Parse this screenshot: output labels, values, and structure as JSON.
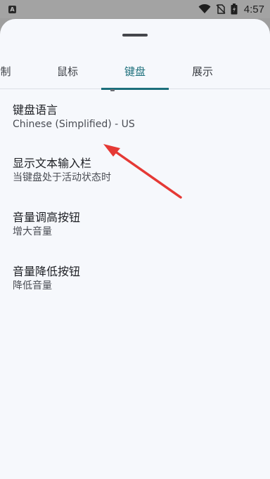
{
  "status_bar": {
    "notification_icon": "a-badge-icon",
    "notification_letter": "A",
    "time": "4:57"
  },
  "tabs": [
    {
      "label": "制",
      "active": false
    },
    {
      "label": "鼠标",
      "active": false
    },
    {
      "label": "键盘",
      "active": true
    },
    {
      "label": "展示",
      "active": false
    }
  ],
  "settings": [
    {
      "title": "键盘语言",
      "subtitle": "Chinese (Simplified) - US"
    },
    {
      "title": "显示文本输入栏",
      "subtitle": "当键盘处于活动状态时"
    },
    {
      "title": "音量调高按钮",
      "subtitle": "增大音量"
    },
    {
      "title": "音量降低按钮",
      "subtitle": "降低音量"
    }
  ],
  "colors": {
    "accent": "#1c6f7b",
    "annotation_arrow": "#e53935",
    "sheet_background": "#f6f8fc"
  }
}
